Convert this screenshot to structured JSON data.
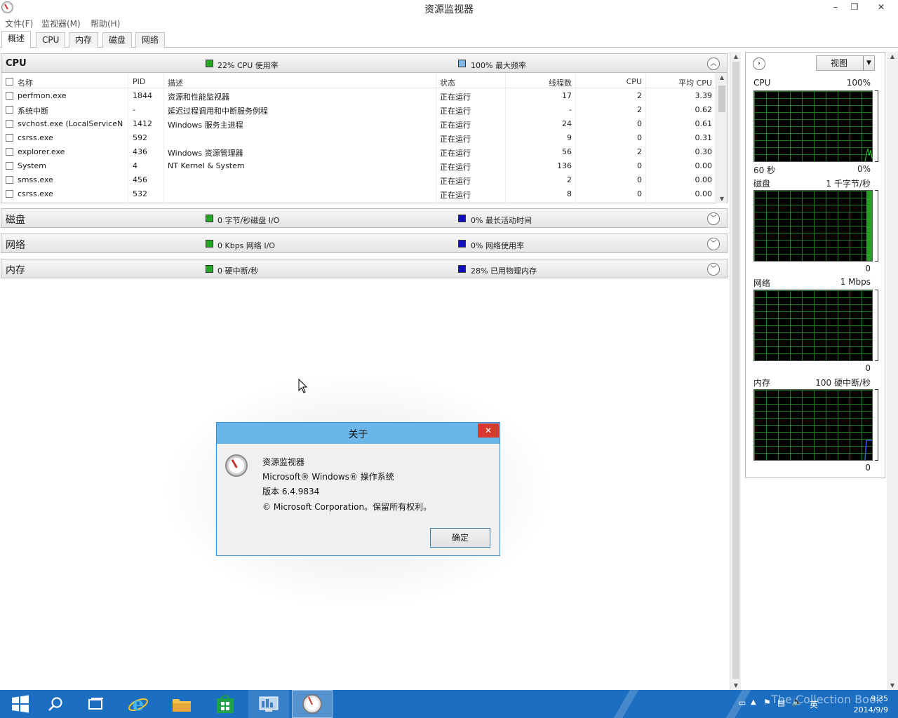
{
  "window": {
    "title": "资源监视器",
    "minimize": "–",
    "restore": "❐",
    "close": "✕"
  },
  "menu": [
    "文件(F)",
    "监视器(M)",
    "帮助(H)"
  ],
  "tabs": [
    "概述",
    "CPU",
    "内存",
    "磁盘",
    "网络"
  ],
  "cpu_section": {
    "title": "CPU",
    "stat1": "22% CPU 使用率",
    "stat2": "100% 最大频率",
    "stat1_color": "#22a822",
    "stat2_color": "#7fb8e8",
    "columns": [
      "名称",
      "PID",
      "描述",
      "状态",
      "线程数",
      "CPU",
      "平均 CPU"
    ],
    "rows": [
      [
        "perfmon.exe",
        "1844",
        "资源和性能监视器",
        "正在运行",
        "17",
        "2",
        "3.39"
      ],
      [
        "系统中断",
        "-",
        "延迟过程调用和中断服务例程",
        "正在运行",
        "-",
        "2",
        "0.62"
      ],
      [
        "svchost.exe (LocalServiceN...",
        "1412",
        "Windows 服务主进程",
        "正在运行",
        "24",
        "0",
        "0.61"
      ],
      [
        "csrss.exe",
        "592",
        "",
        "正在运行",
        "9",
        "0",
        "0.31"
      ],
      [
        "explorer.exe",
        "436",
        "Windows 资源管理器",
        "正在运行",
        "56",
        "2",
        "0.30"
      ],
      [
        "System",
        "4",
        "NT Kernel & System",
        "正在运行",
        "136",
        "0",
        "0.00"
      ],
      [
        "smss.exe",
        "456",
        "",
        "正在运行",
        "2",
        "0",
        "0.00"
      ],
      [
        "csrss.exe",
        "532",
        "",
        "正在运行",
        "8",
        "0",
        "0.00"
      ]
    ]
  },
  "disk_section": {
    "title": "磁盘",
    "stat1": "0 字节/秒磁盘 I/O",
    "stat2": "0% 最长活动时间",
    "stat1_color": "#22a822",
    "stat2_color": "#1010c0"
  },
  "network_section": {
    "title": "网络",
    "stat1": "0 Kbps 网络 I/O",
    "stat2": "0% 网络使用率",
    "stat1_color": "#22a822",
    "stat2_color": "#1010c0"
  },
  "memory_section": {
    "title": "内存",
    "stat1": "0 硬中断/秒",
    "stat2": "28% 已用物理内存",
    "stat1_color": "#22a822",
    "stat2_color": "#1010c0"
  },
  "graph_pane": {
    "view_label": "视图",
    "graphs": [
      {
        "name": "CPU",
        "max": "100%",
        "time": "60 秒",
        "min": "0%"
      },
      {
        "name": "磁盘",
        "max": "1 千字节/秒",
        "min": "0"
      },
      {
        "name": "网络",
        "max": "1 Mbps",
        "min": "0"
      },
      {
        "name": "内存",
        "max": "100 硬中断/秒",
        "min": "0"
      }
    ]
  },
  "dialog": {
    "title": "关于",
    "close": "✕",
    "line1": "资源监视器",
    "line2": "Microsoft® Windows® 操作系统",
    "line3": "版本 6.4.9834",
    "line4": "© Microsoft Corporation。保留所有权利。",
    "ok": "确定"
  },
  "taskbar": {
    "time": "9:35",
    "date": "2014/9/9",
    "ime": "英",
    "watermark": "The Collection Book"
  },
  "colors": {
    "accent_blue": "#1c6ec0",
    "dialog_title": "#6ab6ea",
    "close_red": "#d63a2e",
    "graph_grid": "#1a7a1a"
  }
}
